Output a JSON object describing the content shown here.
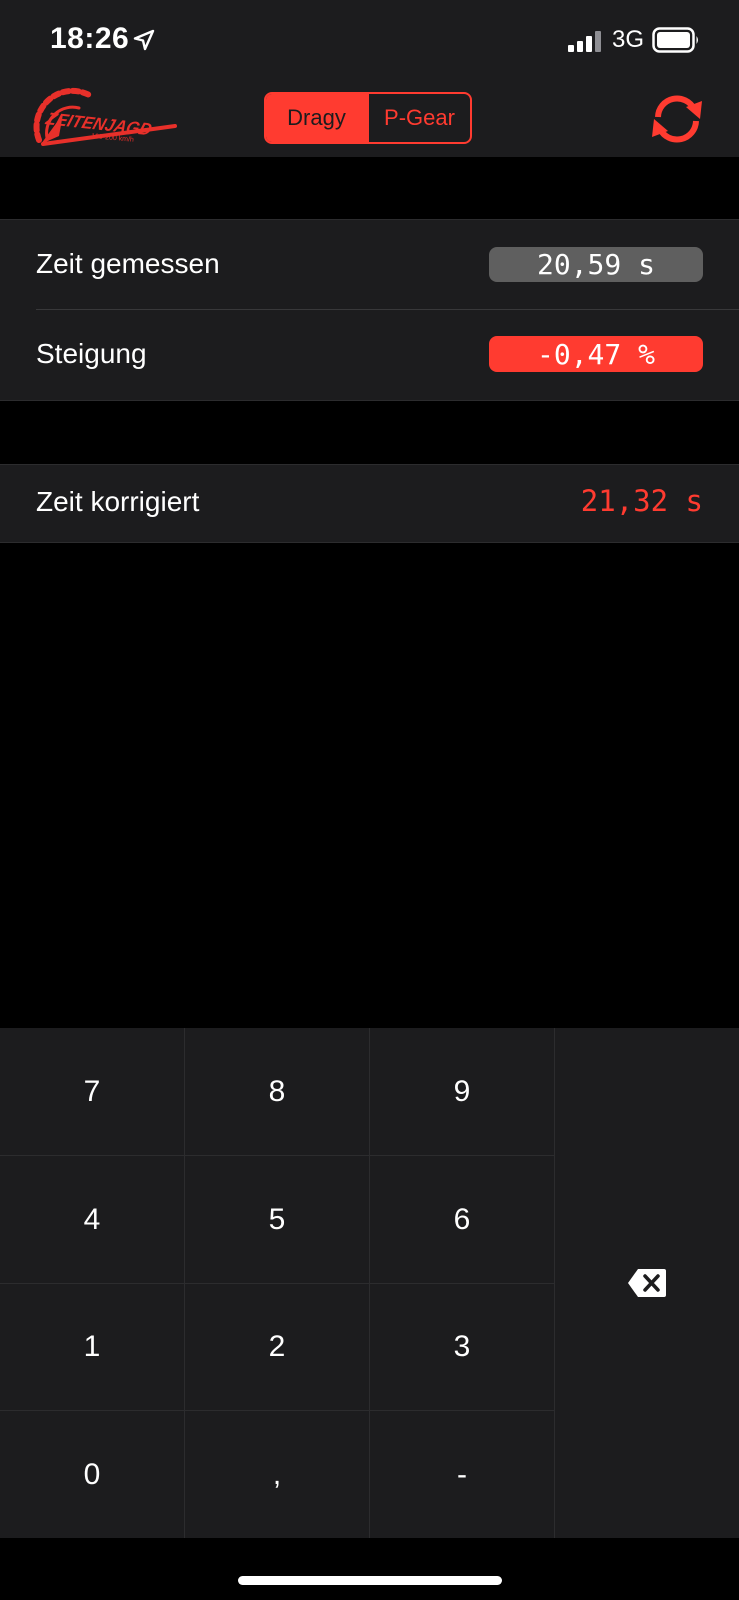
{
  "status_bar": {
    "time": "18:26",
    "network": "3G"
  },
  "nav": {
    "logo_text": "ZEITENJAGD",
    "logo_subtext": "100-200 km/h",
    "segments": [
      {
        "label": "Dragy",
        "active": true
      },
      {
        "label": "P-Gear",
        "active": false
      }
    ],
    "refresh_icon": "refresh-icon"
  },
  "inputs": {
    "time_label": "Zeit gemessen",
    "time_value": "20,59 s",
    "slope_label": "Steigung",
    "slope_value": "-0,47 %"
  },
  "result": {
    "label": "Zeit korrigiert",
    "value": "21,32 s"
  },
  "keypad": {
    "keys": [
      [
        "7",
        "8",
        "9"
      ],
      [
        "4",
        "5",
        "6"
      ],
      [
        "1",
        "2",
        "3"
      ],
      [
        "0",
        ",",
        "-"
      ]
    ],
    "delete_icon": "backspace-icon"
  },
  "colors": {
    "accent": "#ff3b30",
    "surface": "#1c1c1e",
    "background": "#000000",
    "field_grey": "#5f5f5f"
  }
}
